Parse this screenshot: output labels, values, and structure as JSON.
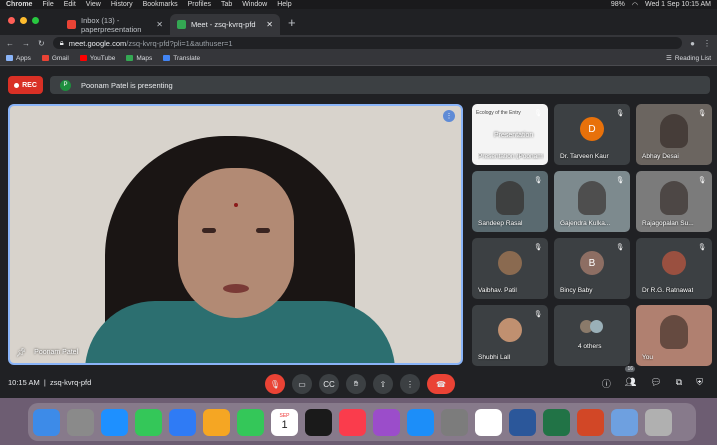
{
  "menubar": {
    "app": "Chrome",
    "items": [
      "File",
      "Edit",
      "View",
      "History",
      "Bookmarks",
      "Profiles",
      "Tab",
      "Window",
      "Help"
    ],
    "battery": "98%",
    "datetime": "Wed 1 Sep  10:15 AM"
  },
  "tabs": [
    {
      "label": "Inbox (13) - paperpresentation",
      "color": "#ea4335"
    },
    {
      "label": "Meet - zsq-kvrq-pfd",
      "color": "#34a853"
    }
  ],
  "url": {
    "host": "meet.google.com",
    "path": "/zsq-kvrq-pfd?pli=1&authuser=1"
  },
  "bookmarks": [
    {
      "label": "Apps",
      "color": "#8ab4f8"
    },
    {
      "label": "Gmail",
      "color": "#ea4335"
    },
    {
      "label": "YouTube",
      "color": "#ff0000"
    },
    {
      "label": "Maps",
      "color": "#34a853"
    },
    {
      "label": "Translate",
      "color": "#4285f4"
    }
  ],
  "reading_list": "Reading List",
  "rec_label": "REC",
  "presenting": {
    "initial": "P",
    "text": "Poonam Patel is presenting"
  },
  "main_speaker": "Poonam Patel",
  "participants": [
    {
      "name": "Presentation (Poonam P...",
      "type": "slide"
    },
    {
      "name": "Dr. Tarveen Kaur",
      "type": "letter",
      "initial": "D",
      "color": "#e8710a"
    },
    {
      "name": "Abhay Desai",
      "type": "video",
      "color": "#6b6560"
    },
    {
      "name": "Sandeep Rasal",
      "type": "video",
      "color": "#5a6a70"
    },
    {
      "name": "Gajendra Kulka...",
      "type": "video",
      "color": "#7d8a8e"
    },
    {
      "name": "Rajagopalan Su...",
      "type": "video",
      "color": "#7b7b7b"
    },
    {
      "name": "Vaibhav. Patil",
      "type": "photo",
      "color": "#8a6a50"
    },
    {
      "name": "Bincy Baby",
      "type": "letter",
      "initial": "B",
      "color": "#8d6e63"
    },
    {
      "name": "Dr R.G. Ratnawat",
      "type": "photo",
      "color": "#9a5040"
    },
    {
      "name": "Shubhi Lall",
      "type": "photo",
      "color": "#c09070"
    },
    {
      "name": "4 others",
      "type": "others"
    },
    {
      "name": "You",
      "type": "video",
      "color": "#b08070"
    }
  ],
  "slide_title": "Ecology of the Entry",
  "slide_sub": "Presentation",
  "bottom": {
    "time": "10:15 AM",
    "meeting": "zsq-kvrq-pfd",
    "people_count": "16"
  },
  "dock": [
    "Finder",
    "Launchpad",
    "Safari",
    "Messages",
    "Mail",
    "Photos",
    "FaceTime",
    "Calendar",
    "TV",
    "Music",
    "Podcasts",
    "App Store",
    "Preferences",
    "Chrome",
    "Word",
    "Excel",
    "PowerPoint",
    "Preview",
    "Trash"
  ],
  "calendar": {
    "month": "SEP",
    "day": "1"
  }
}
